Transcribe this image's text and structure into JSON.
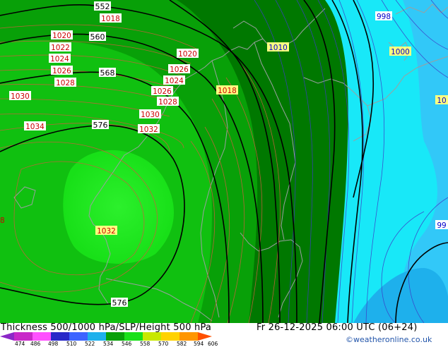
{
  "map": {
    "height_labels": [
      "552",
      "560",
      "568",
      "576",
      "576"
    ],
    "pressure_labels": [
      "1018",
      "1020",
      "1022",
      "1024",
      "1026",
      "1028",
      "1030",
      "1034",
      "1020",
      "1026",
      "1024",
      "1026",
      "1028",
      "1030",
      "1032",
      "1018",
      "1032",
      "1010",
      "1000",
      "998",
      "99",
      "10"
    ],
    "colors": {
      "sea_cyan": "#18e8f8",
      "light_blue": "#32c8f8",
      "mid_blue": "#1eb0ec",
      "dark_green": "#007800",
      "mid_green": "#08a008",
      "green": "#10c010",
      "bright_green": "#18e018",
      "height_contour": "#000000",
      "pressure_contour_land": "#c8603c",
      "pressure_contour_sea": "#3c3cc8",
      "pressure_label_land": "#cc0000",
      "pressure_label_sea": "#0000cc",
      "label_box_yellow": "#ffff80"
    }
  },
  "footer": {
    "title": "Thickness 500/1000 hPa/SLP/Height 500 hPa",
    "datetime": "Fr 26-12-2025 06:00 UTC (06+24)",
    "credit": "©weatheronline.co.uk",
    "scale_ticks": [
      "474",
      "486",
      "498",
      "510",
      "522",
      "534",
      "546",
      "558",
      "570",
      "582",
      "594",
      "606"
    ],
    "scale_colors": [
      "#8c28c8",
      "#c828c8",
      "#ff50ff",
      "#2828c8",
      "#3c64ff",
      "#1eb0ec",
      "#08a008",
      "#18e018",
      "#c8e800",
      "#ffd200",
      "#ff9600",
      "#ff5000"
    ]
  }
}
